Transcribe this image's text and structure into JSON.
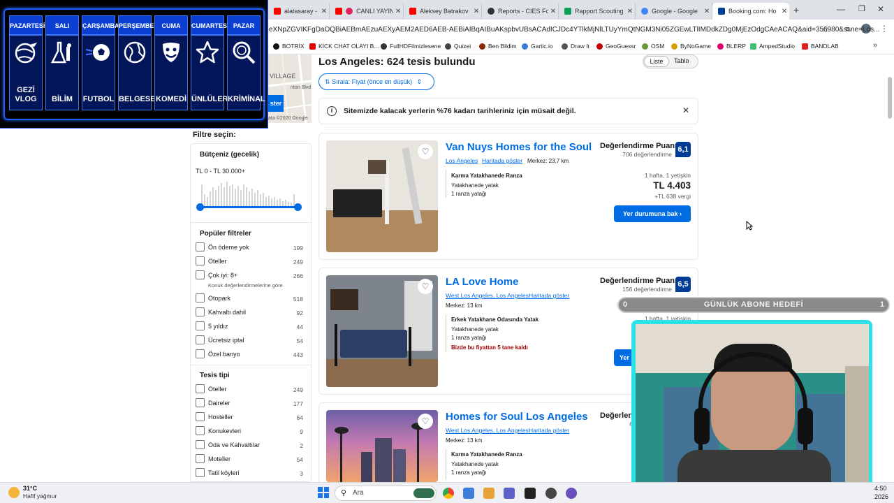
{
  "browser": {
    "tabs": [
      {
        "label": "alatasaray - You",
        "color": "#ff0000"
      },
      {
        "label": "CANLI YAYIN |",
        "color": "#ff0000"
      },
      {
        "label": "Aleksey Batrakov",
        "color": "#ff0000"
      },
      {
        "label": "Reports - CIES Fo",
        "color": "#333333"
      },
      {
        "label": "Rapport Scouting",
        "color": "#0f9d58"
      },
      {
        "label": "Google - Google",
        "color": "#4285f4"
      },
      {
        "label": "Booking.com: Ho",
        "color": "#003b95"
      }
    ],
    "url": "eXNpZGVIKFgDaOQBiAEBmAEzuAEXyAEM2AED6AEB-AEBiAIBqAIBuAKspbvUBsACAdICJDc4YTlkMjNlLTUyYmQtNGM3Ni05ZGEwLTlIMDdkZDg0MjEzOdgCAeACAQ&aid=356980&ssne=Los...",
    "bookmarks": [
      {
        "label": "BOTRİX",
        "color": "#111111"
      },
      {
        "label": "KİCK CHAT OLAYI B...",
        "color": "#e00000"
      },
      {
        "label": "FullHDFilmizlesene",
        "color": "#333333"
      },
      {
        "label": "Quizei",
        "color": "#444444"
      },
      {
        "label": "Ben Bildim",
        "color": "#8b2500"
      },
      {
        "label": "Gartic.io",
        "color": "#3a7bd5"
      },
      {
        "label": "Draw It",
        "color": "#555555"
      },
      {
        "label": "GeoGuessr",
        "color": "#c00000"
      },
      {
        "label": "OSM",
        "color": "#6a9a3a"
      },
      {
        "label": "ByNoGame",
        "color": "#d4a000"
      },
      {
        "label": "BLERP",
        "color": "#e0006b"
      },
      {
        "label": "AmpedStudio",
        "color": "#3fbf6f"
      },
      {
        "label": "BANDLAB",
        "color": "#e02020"
      }
    ]
  },
  "overlay": {
    "days": [
      "PAZARTESİ",
      "SALI",
      "ÇARŞAMBA",
      "PERŞEMBE",
      "CUMA",
      "CUMARTESİ",
      "PAZAR"
    ],
    "categories": [
      {
        "label": "GEZİ VLOG",
        "icon": "globe-plane-icon"
      },
      {
        "label": "BİLİM",
        "icon": "science-icon"
      },
      {
        "label": "FUTBOL",
        "icon": "football-icon"
      },
      {
        "label": "BELGESEL",
        "icon": "globe-icon"
      },
      {
        "label": "KOMEDİ",
        "icon": "theater-masks-icon"
      },
      {
        "label": "ÜNLÜLER",
        "icon": "star-icon"
      },
      {
        "label": "KRİMİNAL",
        "icon": "magnifier-icon"
      }
    ]
  },
  "map": {
    "street": "VILLAGE",
    "button": "ster",
    "road": "nton Blvd",
    "credit": "ata ©2026 Google"
  },
  "results": {
    "heading": "Los Angeles: 624 tesis bulundu",
    "view_list": "Liste",
    "view_table": "Tablo",
    "sort_label": "Sırala: Fiyat (önce en düşük)",
    "notice": "Sitemizde kalacak yerlerin %76 kadarı tarihleriniz için müsait değil."
  },
  "filters": {
    "title": "Filtre seçin:",
    "budget_title": "Bütçeniz (gecelik)",
    "budget_range": "TL 0 - TL 30.000+",
    "popular_title": "Popüler filtreler",
    "popular": [
      {
        "label": "Ön ödeme yok",
        "count": "199"
      },
      {
        "label": "Oteller",
        "count": "249"
      },
      {
        "label": "Çok iyi: 8+",
        "count": "266",
        "sub": "Konuk değerlendirmelerine göre"
      },
      {
        "label": "Otopark",
        "count": "518"
      },
      {
        "label": "Kahvaltı dahil",
        "count": "92"
      },
      {
        "label": "5 yıldız",
        "count": "44"
      },
      {
        "label": "Ücretsiz iptal",
        "count": "54"
      },
      {
        "label": "Özel banyo",
        "count": "443"
      }
    ],
    "type_title": "Tesis tipi",
    "types": [
      {
        "label": "Oteller",
        "count": "249"
      },
      {
        "label": "Daireler",
        "count": "177"
      },
      {
        "label": "Hosteller",
        "count": "64"
      },
      {
        "label": "Konukevleri",
        "count": "9"
      },
      {
        "label": "Oda ve Kahvaltılar",
        "count": "2"
      },
      {
        "label": "Moteller",
        "count": "54"
      },
      {
        "label": "Tatil köyleri",
        "count": "3"
      }
    ]
  },
  "hotels": [
    {
      "name": "Van Nuys Homes for the Soul",
      "area": "Los Angeles",
      "map_link": "Haritada göster",
      "distance": "Merkez: 23,7 km",
      "room": "Karma Yatakhanede Ranza",
      "bed_type": "Yatakhanede yatak",
      "beds": "1 ranza yatağı",
      "rating_title": "Değerlendirme Puanı",
      "reviews": "706 değerlendirme",
      "score": "6,1",
      "stay": "1 hafta, 1 yetişkin",
      "price": "TL 4.403",
      "tax": "+TL 638 vergi",
      "button": "Yer durumuna bak"
    },
    {
      "name": "LA Love Home",
      "area": "West Los Angeles, Los Angeles",
      "map_link": "Haritada göster",
      "distance": "Merkez: 13 km",
      "room": "Erkek Yatakhane Odasında Yatak",
      "bed_type": "Yatakhanede yatak",
      "beds": "1 ranza yatağı",
      "warning": "Bizde bu fiyattan 5 tane kaldı",
      "rating_title": "Değerlendirme Puanı",
      "reviews": "156 değerlendirme",
      "score": "6,5",
      "stay": "1 hafta, 1 yetişkin",
      "button": "Yer d"
    },
    {
      "name": "Homes for Soul Los Angeles",
      "area": "West Los Angeles, Los Angeles",
      "map_link": "Haritada göster",
      "distance": "Merkez: 13 km",
      "room": "Karma Yatakhanede Ranza",
      "bed_type": "Yatakhanede yatak",
      "beds": "1 ranza yatağı",
      "rating_title": "Değerlen",
      "reviews": "6"
    }
  ],
  "goal": {
    "left": "0",
    "label": "GÜNLÜK ABONE HEDEFİ",
    "right": "1"
  },
  "taskbar": {
    "temp": "31°C",
    "weather": "Hafif yağmur",
    "search": "Ara",
    "time": "4:50",
    "date": "2026"
  }
}
